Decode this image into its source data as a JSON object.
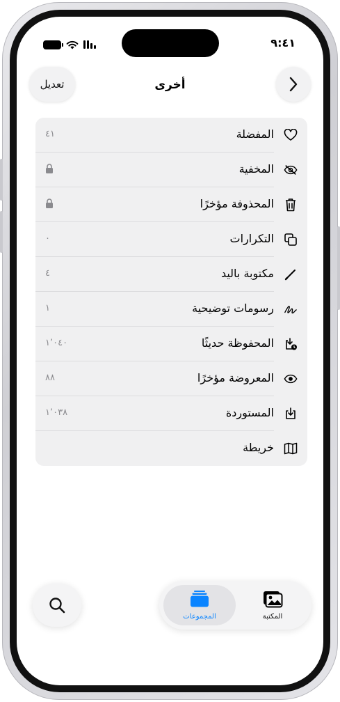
{
  "status_bar": {
    "time": "٩:٤١"
  },
  "nav": {
    "title": "أخرى",
    "edit_label": "تعديل"
  },
  "rows": [
    {
      "label": "المفضلة",
      "value": "٤١",
      "icon": "heart-icon"
    },
    {
      "label": "المخفية",
      "value": "",
      "locked": true,
      "icon": "eye-slash-icon"
    },
    {
      "label": "المحذوفة مؤخرًا",
      "value": "",
      "locked": true,
      "icon": "trash-icon"
    },
    {
      "label": "التكرارات",
      "value": "٠",
      "icon": "duplicate-icon"
    },
    {
      "label": "مكتوبة باليد",
      "value": "٤",
      "icon": "pencil-icon"
    },
    {
      "label": "رسومات توضيحية",
      "value": "١",
      "icon": "scribble-icon"
    },
    {
      "label": "المحفوظة حديثًا",
      "value": "١٬٠٤٠",
      "icon": "saved-icon"
    },
    {
      "label": "المعروضة مؤخرًا",
      "value": "٨٨",
      "icon": "eye-icon"
    },
    {
      "label": "المستوردة",
      "value": "١٬٠٣٨",
      "icon": "import-icon"
    },
    {
      "label": "خريطة",
      "value": "",
      "icon": "map-icon"
    }
  ],
  "tabbar": {
    "collections_label": "المجموعات",
    "library_label": "المكتبة"
  },
  "colors": {
    "accent": "#0a84ff",
    "list_bg": "#f0f0f1",
    "secondary_text": "#8a8a8e"
  }
}
